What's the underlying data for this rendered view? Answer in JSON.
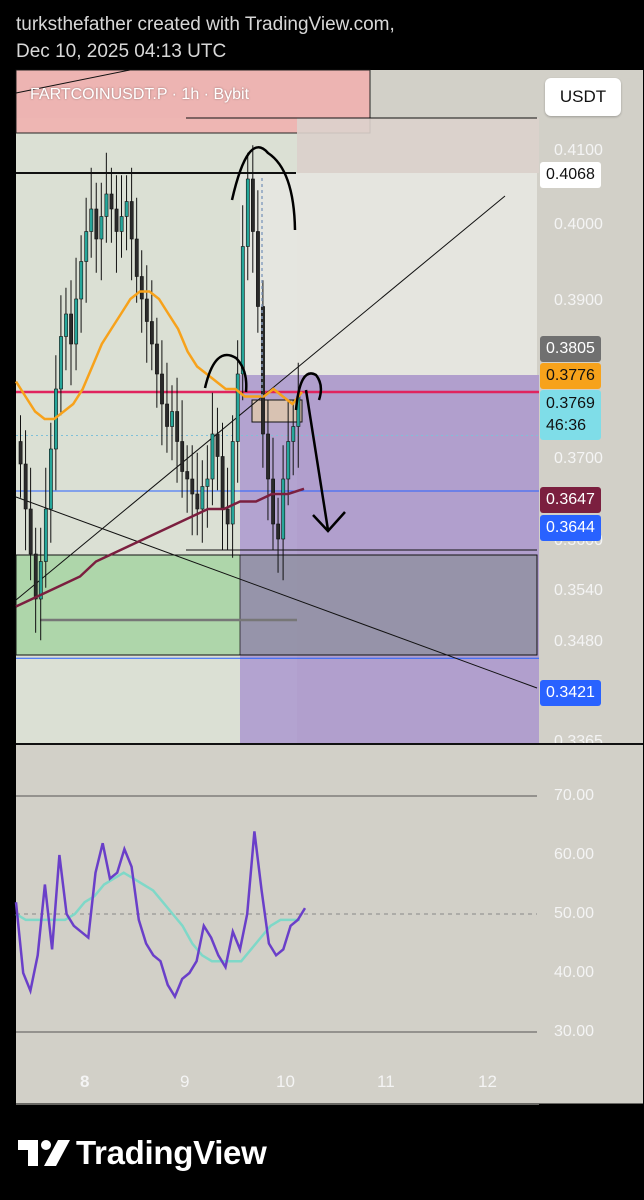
{
  "header": {
    "credit": "turksthefather created with TradingView.com,",
    "date": "Dec 10, 2025 04:13 UTC"
  },
  "symbol": {
    "label": "FARTCOINUSDT.P · 1h · Bybit"
  },
  "currency_button": {
    "label": "USDT"
  },
  "price_axis": {
    "ticks": [
      "0.4100",
      "0.4000",
      "0.3900",
      "0.3700",
      "0.3600",
      "0.3540",
      "0.3480",
      "0.3365"
    ]
  },
  "price_badges": {
    "top_box": "0.4068",
    "level_3805": "0.3805",
    "ema_3776": "0.3776",
    "current_price": "0.3769",
    "countdown": "46:36",
    "ma_3647": "0.3647",
    "line_3644": "0.3644",
    "line_3421": "0.3421"
  },
  "rsi_axis": {
    "ticks": [
      "70.00",
      "60.00",
      "50.00",
      "40.00",
      "30.00"
    ]
  },
  "time_axis": {
    "ticks": [
      "8",
      "9",
      "10",
      "11",
      "12"
    ]
  },
  "colors": {
    "chart_bg": "#d2d0c8",
    "up_candle": "#26a69a",
    "down_candle": "#2a2a2a",
    "ema_orange": "#f7a21b",
    "ma_maroon": "#7b1f3f",
    "red_line": "#e0245e",
    "blue_line": "#2962ff",
    "rsi_line": "#6a3fc9",
    "rsi_ma": "#7fd8c8",
    "purple_zone": "#a68fcf",
    "green_zone": "#a8d5a5",
    "pink_box": "#f1b2b0"
  },
  "brand": {
    "name": "TradingView"
  },
  "chart_data": [
    {
      "type": "candlestick",
      "title": "FARTCOINUSDT.P · 1h · Bybit",
      "x_ticks": [
        "8",
        "9",
        "10",
        "11",
        "12"
      ],
      "ylim": [
        0.333,
        0.416
      ],
      "current_price": 0.3769,
      "levels": [
        0.4068,
        0.3805,
        0.3776,
        0.3647,
        0.3644,
        0.3421
      ],
      "series": [
        {
          "name": "close",
          "values": [
            0.368,
            0.362,
            0.356,
            0.35,
            0.355,
            0.362,
            0.37,
            0.378,
            0.385,
            0.388,
            0.384,
            0.39,
            0.395,
            0.399,
            0.402,
            0.398,
            0.401,
            0.404,
            0.402,
            0.399,
            0.401,
            0.403,
            0.398,
            0.393,
            0.39,
            0.387,
            0.384,
            0.38,
            0.376,
            0.373,
            0.375,
            0.371,
            0.367,
            0.366,
            0.364,
            0.362,
            0.365,
            0.366,
            0.372,
            0.369,
            0.362,
            0.36,
            0.371,
            0.38,
            0.397,
            0.406,
            0.399,
            0.389,
            0.372,
            0.366,
            0.36,
            0.358,
            0.366,
            0.371,
            0.373,
            0.377
          ]
        },
        {
          "name": "EMA",
          "values": [
            0.379,
            0.377,
            0.375,
            0.374,
            0.374,
            0.375,
            0.376,
            0.378,
            0.381,
            0.384,
            0.386,
            0.388,
            0.39,
            0.391,
            0.391,
            0.39,
            0.388,
            0.386,
            0.383,
            0.381,
            0.38,
            0.379,
            0.378,
            0.378,
            0.377,
            0.377,
            0.377,
            0.378,
            0.377,
            0.376,
            0.3776
          ]
        },
        {
          "name": "MA",
          "values": [
            0.349,
            0.35,
            0.351,
            0.352,
            0.353,
            0.355,
            0.356,
            0.357,
            0.358,
            0.359,
            0.36,
            0.361,
            0.362,
            0.362,
            0.363,
            0.363,
            0.364,
            0.364,
            0.3647
          ]
        }
      ]
    },
    {
      "type": "line",
      "ylim": [
        30,
        70
      ],
      "y_ticks": [
        70,
        60,
        50,
        40,
        30
      ],
      "series": [
        {
          "name": "RSI",
          "values": [
            52,
            40,
            37,
            43,
            55,
            44,
            60,
            50,
            48,
            47,
            46,
            57,
            62,
            56,
            57,
            61,
            58,
            49,
            45,
            43,
            42,
            38,
            36,
            39,
            40,
            42,
            48,
            46,
            43,
            41,
            47,
            44,
            50,
            64,
            54,
            45,
            43,
            44,
            48,
            49,
            51
          ]
        },
        {
          "name": "RSI MA",
          "values": [
            50,
            49,
            49,
            49,
            49,
            49,
            50,
            52,
            53,
            55,
            56,
            57,
            56,
            55,
            54,
            52,
            50,
            48,
            45,
            43,
            42,
            42,
            42,
            42,
            44,
            46,
            48,
            49,
            49,
            49
          ]
        }
      ]
    }
  ]
}
